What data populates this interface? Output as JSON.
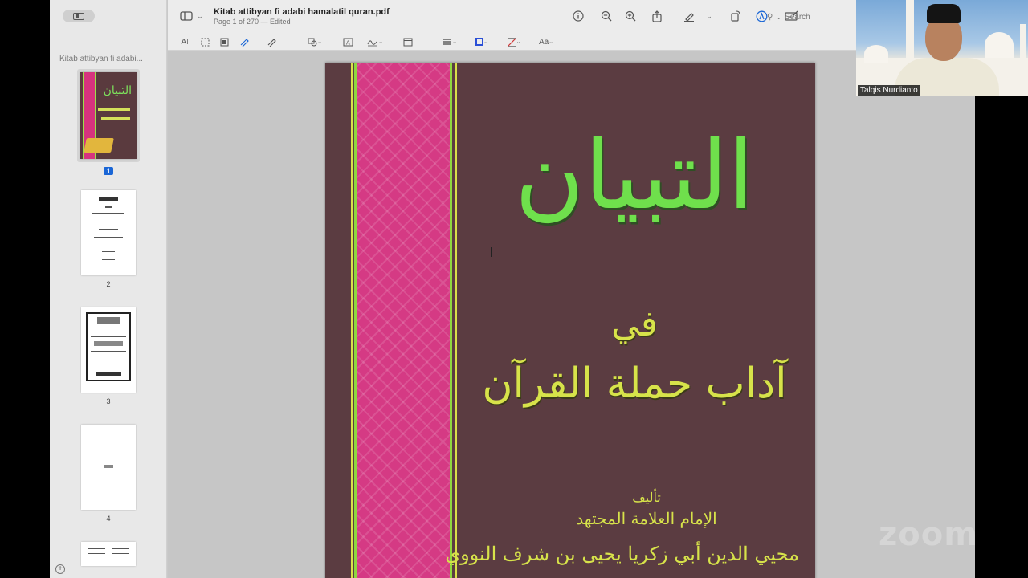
{
  "window": {
    "doc_title": "Kitab attibyan fi adabi hamalatil quran.pdf",
    "doc_subtitle": "Page 1 of 270 — Edited"
  },
  "toolbar": {
    "search_placeholder": "Search",
    "text_style_label": "Aa",
    "icons": [
      "sidebar-icon",
      "info-icon",
      "zoom-out-icon",
      "zoom-in-icon",
      "share-icon",
      "highlight-pen-icon",
      "rotate-icon",
      "markup-icon",
      "form-icon",
      "search-icon"
    ],
    "markup_icons": [
      "text-selection-icon",
      "rect-selection-icon",
      "redact-icon",
      "sketch-icon",
      "draw-icon",
      "shapes-icon",
      "text-box-icon",
      "sign-icon",
      "note-icon",
      "shape-style-icon",
      "border-color-icon",
      "fill-color-icon",
      "text-style-icon"
    ],
    "border_color": "#2a4fd6",
    "fill_color": "#d03838"
  },
  "sidebar": {
    "title": "Kitab attibyan fi adabi...",
    "pages": [
      {
        "number": "1",
        "selected": true
      },
      {
        "number": "2",
        "selected": false
      },
      {
        "number": "3",
        "selected": false
      },
      {
        "number": "4",
        "selected": false
      }
    ]
  },
  "cover": {
    "title": "التبيان",
    "fi": "في",
    "subtitle": "آداب حملة القرآن",
    "by": "تأليف",
    "imam": "الإمام العلامة المجتهد",
    "author": "محيي الدين أبي زكريا يحيى بن شرف النووي",
    "colors": {
      "background": "#5b3c41",
      "spine": "#d53a84",
      "title": "#6fe04c",
      "text": "#d7e34a"
    }
  },
  "video": {
    "participant_name": "Talqis Nurdianto"
  },
  "watermark": {
    "text": "zoom"
  }
}
